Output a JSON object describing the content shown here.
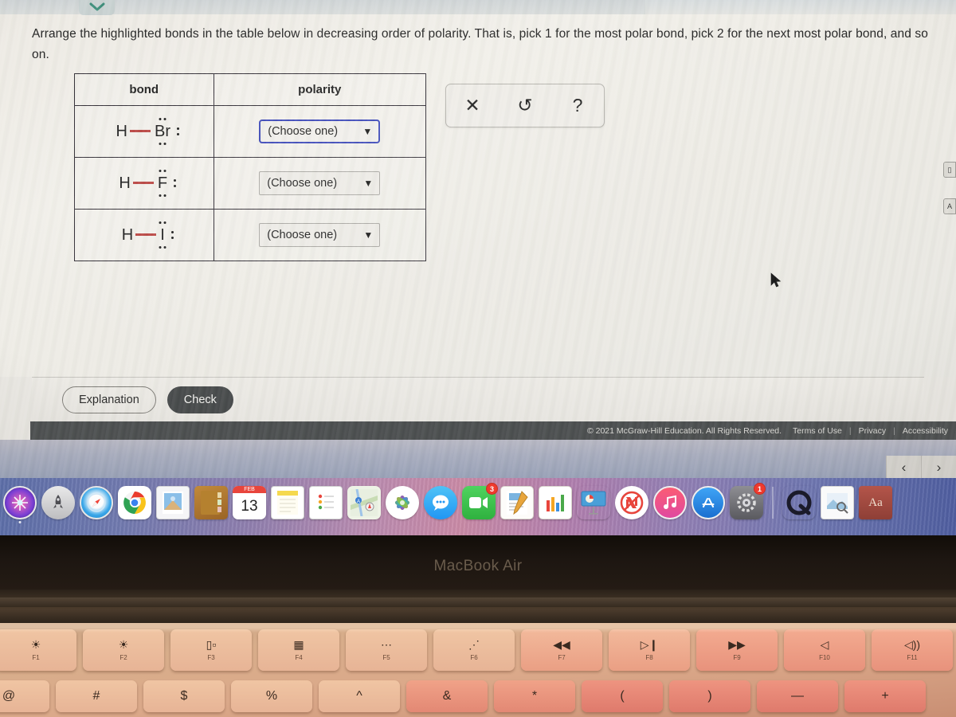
{
  "prompt": "Arrange the highlighted bonds in the table below in decreasing order of polarity. That is, pick 1 for the most polar bond, pick 2 for the next most polar bond, and so on.",
  "table": {
    "headers": [
      "bond",
      "polarity"
    ],
    "rows": [
      {
        "bond_label": "H—Br:",
        "atom": "Br",
        "select_value": "(Choose one)",
        "focused": true
      },
      {
        "bond_label": "H—F:",
        "atom": "F",
        "select_value": "(Choose one)",
        "focused": false
      },
      {
        "bond_label": "H—I:",
        "atom": "I",
        "select_value": "(Choose one)",
        "focused": false
      }
    ]
  },
  "tool_palette": {
    "clear": "✕",
    "undo": "↺",
    "help": "?"
  },
  "buttons": {
    "explanation": "Explanation",
    "check": "Check"
  },
  "footer": {
    "copyright": "© 2021 McGraw-Hill Education. All Rights Reserved.",
    "terms": "Terms of Use",
    "privacy": "Privacy",
    "accessibility": "Accessibility",
    "separator": "|"
  },
  "page_nav": {
    "prev": "‹",
    "next": "›"
  },
  "colors": {
    "bond_highlight": "#b8423f",
    "focus_border": "#3a46b8",
    "check_button": "#474a4b",
    "footer_bar": "#4b4e4f"
  },
  "dock": {
    "items": [
      {
        "name": "siri",
        "label": "",
        "badge": null
      },
      {
        "name": "launchpad",
        "label": "",
        "badge": null
      },
      {
        "name": "safari",
        "label": "",
        "badge": null
      },
      {
        "name": "chrome",
        "label": "",
        "badge": null
      },
      {
        "name": "mail",
        "label": "",
        "badge": null
      },
      {
        "name": "contacts",
        "label": "",
        "badge": null
      },
      {
        "name": "calendar",
        "label": "13",
        "badge": null,
        "month": "FEB"
      },
      {
        "name": "notes",
        "label": "",
        "badge": null
      },
      {
        "name": "reminders",
        "label": "",
        "badge": null
      },
      {
        "name": "maps",
        "label": "",
        "badge": null
      },
      {
        "name": "photos",
        "label": "",
        "badge": null
      },
      {
        "name": "messages",
        "label": "",
        "badge": null
      },
      {
        "name": "facetime",
        "label": "",
        "badge": "3"
      },
      {
        "name": "pages",
        "label": "",
        "badge": null
      },
      {
        "name": "numbers",
        "label": "",
        "badge": null
      },
      {
        "name": "keynote",
        "label": "",
        "badge": null
      },
      {
        "name": "news",
        "label": "",
        "badge": null
      },
      {
        "name": "music",
        "label": "",
        "badge": null
      },
      {
        "name": "app-store",
        "label": "",
        "badge": null
      },
      {
        "name": "system-preferences",
        "label": "",
        "badge": "1"
      },
      {
        "name": "quicktime",
        "label": "Q",
        "badge": null
      },
      {
        "name": "preview",
        "label": "",
        "badge": null
      },
      {
        "name": "dictionary",
        "label": "Aa",
        "badge": null
      }
    ]
  },
  "laptop": {
    "model": "MacBook Air"
  },
  "keyboard": {
    "function_keys": [
      {
        "key": "F1",
        "glyph": "☀",
        "name": "brightness-down"
      },
      {
        "key": "F2",
        "glyph": "☀",
        "name": "brightness-up"
      },
      {
        "key": "F3",
        "glyph": "▯▫",
        "name": "mission-control"
      },
      {
        "key": "F4",
        "glyph": "▦",
        "name": "launchpad"
      },
      {
        "key": "F5",
        "glyph": "⋯",
        "name": "keyboard-backlight-down"
      },
      {
        "key": "F6",
        "glyph": "⋰",
        "name": "keyboard-backlight-up"
      },
      {
        "key": "F7",
        "glyph": "◀◀",
        "name": "rewind"
      },
      {
        "key": "F8",
        "glyph": "▷❙",
        "name": "play-pause"
      },
      {
        "key": "F9",
        "glyph": "▶▶",
        "name": "fast-forward"
      },
      {
        "key": "F10",
        "glyph": "◁",
        "name": "mute"
      },
      {
        "key": "F11",
        "glyph": "◁))",
        "name": "volume-down"
      }
    ],
    "number_row": [
      "@",
      "#",
      "$",
      "%",
      "^",
      "&",
      "*",
      "(",
      ")",
      "—",
      "+"
    ]
  }
}
